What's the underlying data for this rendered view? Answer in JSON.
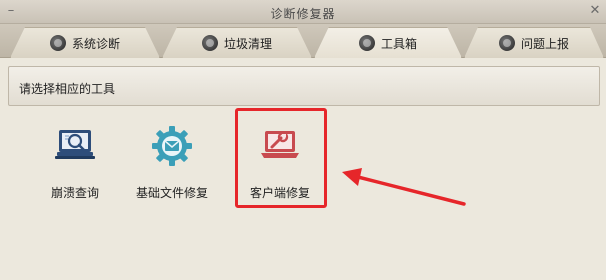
{
  "window": {
    "title": "诊断修复器",
    "minimize_glyph": "–",
    "close_glyph": "✕"
  },
  "tabs": [
    {
      "label": "系统诊断",
      "icon": "camera-lens-icon",
      "active": false
    },
    {
      "label": "垃圾清理",
      "icon": "camera-lens-icon",
      "active": false
    },
    {
      "label": "工具箱",
      "icon": "camera-lens-icon",
      "active": true
    },
    {
      "label": "问题上报",
      "icon": "camera-lens-icon",
      "active": false
    }
  ],
  "section": {
    "header": "请选择相应的工具"
  },
  "tools": [
    {
      "label": "崩溃查询",
      "icon": "monitor-search-icon",
      "color": "#2d4d7a"
    },
    {
      "label": "基础文件修复",
      "icon": "gear-mail-icon",
      "color": "#3b9fb8"
    },
    {
      "label": "客户端修复",
      "icon": "laptop-wrench-icon",
      "color": "#c84a4f"
    }
  ],
  "annotation": {
    "highlight_color": "#e6262a"
  }
}
